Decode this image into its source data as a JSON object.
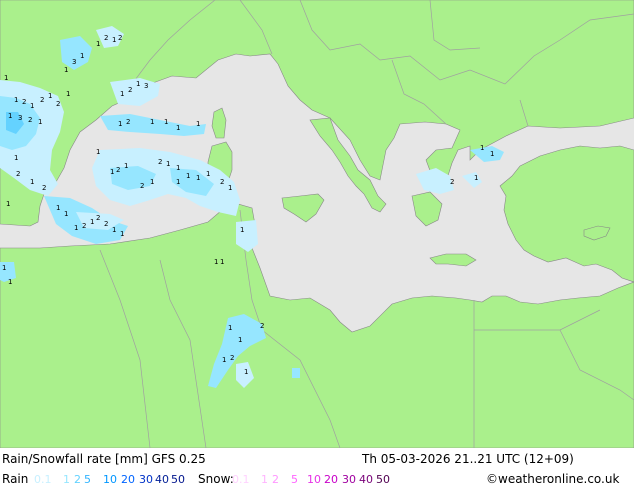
{
  "title": "Rain/Snowfall rate [mm] GFS 0.25",
  "valid_time": "Th 05-03-2026 21..21 UTC (12+09)",
  "credit": "©weatheronline.co.uk",
  "legend": {
    "rain_label": "Rain",
    "snow_label": "Snow:",
    "rain": [
      {
        "text": "0.1",
        "color": "#c8f0ff"
      },
      {
        "text": "1",
        "color": "#96e6ff"
      },
      {
        "text": "2",
        "color": "#64d2ff"
      },
      {
        "text": "5",
        "color": "#32b4ff"
      },
      {
        "text": "10",
        "color": "#0096ff"
      },
      {
        "text": "20",
        "color": "#0064ff"
      },
      {
        "text": "30",
        "color": "#0032c8"
      },
      {
        "text": "40",
        "color": "#001e96"
      },
      {
        "text": "50",
        "color": "#00148c"
      }
    ],
    "snow": [
      {
        "text": "0.1",
        "color": "#ffd2ff"
      },
      {
        "text": "1",
        "color": "#ffb4ff"
      },
      {
        "text": "2",
        "color": "#ff96ff"
      },
      {
        "text": "5",
        "color": "#ff64ff"
      },
      {
        "text": "10",
        "color": "#e632e6"
      },
      {
        "text": "20",
        "color": "#c800c8"
      },
      {
        "text": "30",
        "color": "#a000a0"
      },
      {
        "text": "40",
        "color": "#780078"
      },
      {
        "text": "50",
        "color": "#500050"
      }
    ]
  },
  "map_colors": {
    "land": "#aaf08c",
    "sea": "#e6e6e6",
    "border": "#a0a0a0",
    "precip_light": "#c8f0ff",
    "precip": "#96e6ff",
    "precip_heavy": "#64d2ff"
  },
  "map_labels": [
    "1",
    "2",
    "3"
  ]
}
